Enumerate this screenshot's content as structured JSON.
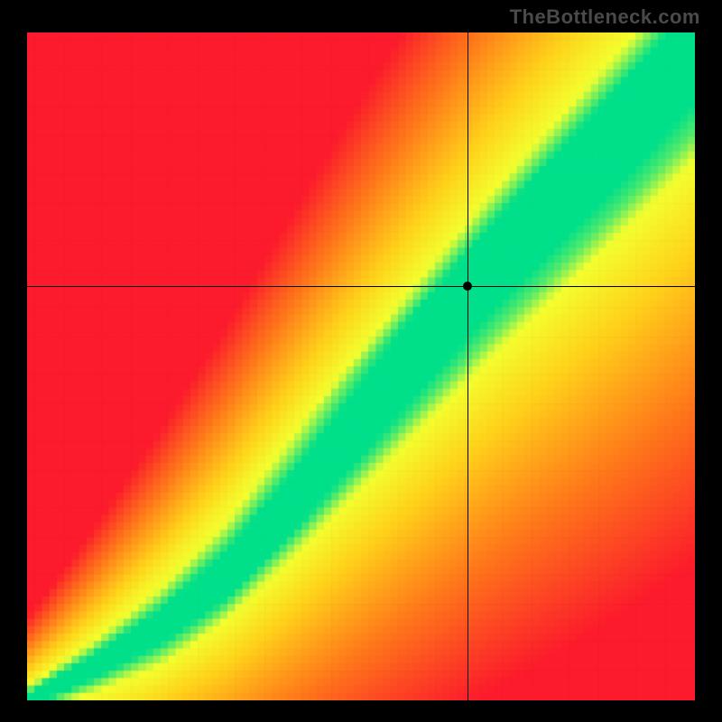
{
  "watermark": "TheBottleneck.com",
  "chart_data": {
    "type": "heatmap",
    "title": "",
    "xlabel": "",
    "ylabel": "",
    "xlim": [
      0,
      100
    ],
    "ylim": [
      0,
      100
    ],
    "marker": {
      "x": 66,
      "y": 62
    },
    "crosshair": {
      "x": 66,
      "y": 62
    },
    "gradient_stops": {
      "worst": "#fc1b2c",
      "bad": "#ff7a1a",
      "mid": "#ffd21a",
      "near": "#f4ff2f",
      "best": "#00e08a"
    },
    "optimal_curve": [
      {
        "x": 0,
        "y": 0
      },
      {
        "x": 10,
        "y": 5
      },
      {
        "x": 20,
        "y": 11
      },
      {
        "x": 30,
        "y": 19
      },
      {
        "x": 40,
        "y": 30
      },
      {
        "x": 50,
        "y": 42
      },
      {
        "x": 60,
        "y": 54
      },
      {
        "x": 70,
        "y": 66
      },
      {
        "x": 80,
        "y": 77
      },
      {
        "x": 90,
        "y": 88
      },
      {
        "x": 100,
        "y": 100
      }
    ],
    "band_width_fraction_at_max": 0.22,
    "pixelation": 90
  }
}
